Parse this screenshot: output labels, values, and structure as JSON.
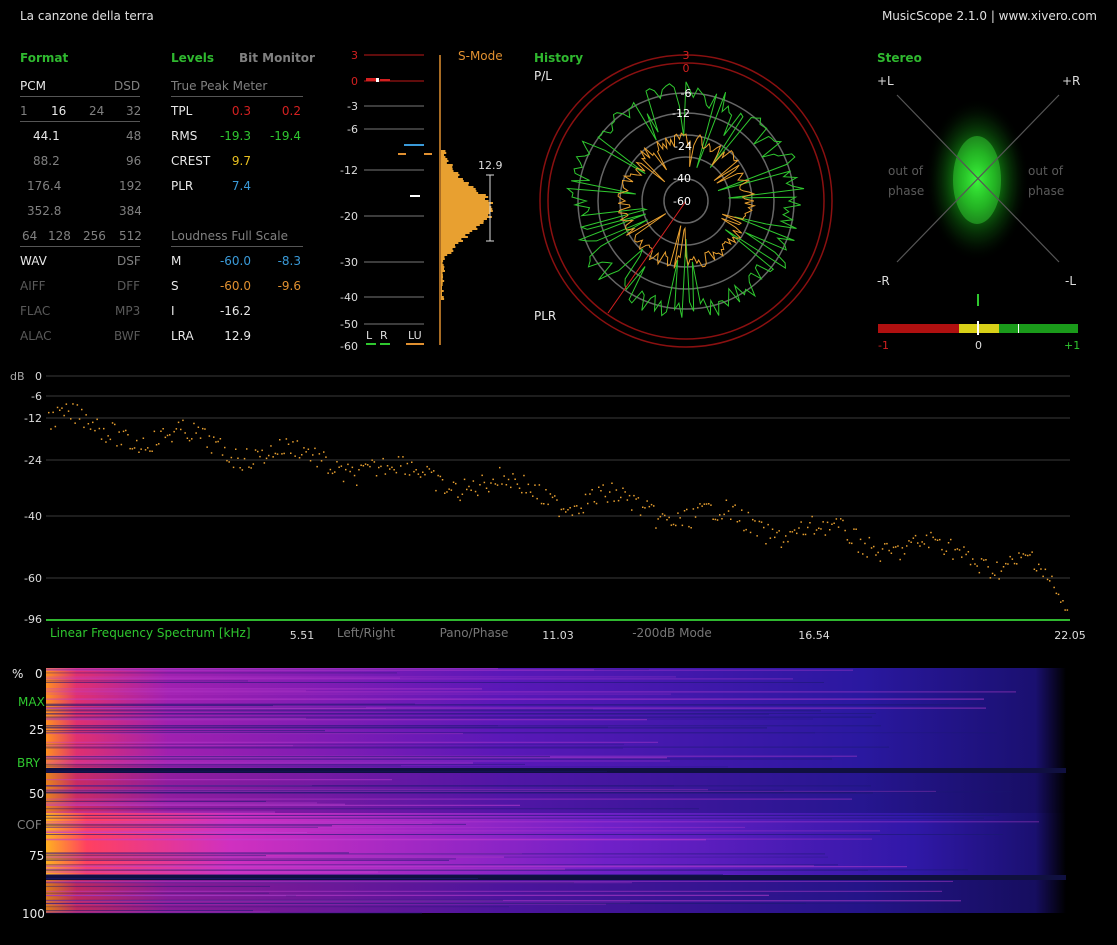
{
  "header": {
    "track_title": "La canzone della terra",
    "app_info": "MusicScope 2.1.0 | www.xivero.com"
  },
  "format": {
    "title": "Format",
    "pcm": "PCM",
    "dsd": "DSD",
    "bits": [
      "1",
      "16",
      "24",
      "32"
    ],
    "rates_pcm": [
      "44.1",
      "88.2",
      "176.4",
      "352.8"
    ],
    "rates_dsd": [
      "48",
      "96",
      "192",
      "384"
    ],
    "dsd_rates": [
      "64",
      "128",
      "256",
      "512"
    ],
    "formats_left": [
      "WAV",
      "AIFF",
      "FLAC",
      "ALAC"
    ],
    "formats_right": [
      "DSF",
      "DFF",
      "MP3",
      "BWF"
    ]
  },
  "levels": {
    "title": "Levels",
    "bit_monitor": "Bit Monitor",
    "true_peak_title": "True Peak Meter",
    "rows": [
      {
        "label": "TPL",
        "l": "0.3",
        "r": "0.2"
      },
      {
        "label": "RMS",
        "l": "-19.3",
        "r": "-19.4"
      },
      {
        "label": "CREST",
        "l": "9.7",
        "r": ""
      },
      {
        "label": "PLR",
        "l": "7.4",
        "r": ""
      }
    ],
    "loudness_title": "Loudness Full Scale",
    "loud_rows": [
      {
        "label": "M",
        "l": "-60.0",
        "r": "-8.3"
      },
      {
        "label": "S",
        "l": "-60.0",
        "r": "-9.6"
      },
      {
        "label": "I",
        "l": "-16.2",
        "r": ""
      },
      {
        "label": "LRA",
        "l": "12.9",
        "r": ""
      }
    ]
  },
  "meter": {
    "smode": "S-Mode",
    "scale": [
      "3",
      "0",
      "-3",
      "-6",
      "-12",
      "-20",
      "-30",
      "-40",
      "-50",
      "-60"
    ],
    "lra_value": "12.9",
    "labels": [
      "L",
      "R",
      "LU"
    ]
  },
  "history": {
    "title": "History",
    "pl": "P/L",
    "plr": "PLR",
    "rings": [
      "3",
      "0",
      "-6",
      "-12",
      "-24",
      "-40",
      "-60"
    ]
  },
  "stereo": {
    "title": "Stereo",
    "pl": "+L",
    "pr": "+R",
    "ml": "-R",
    "mr": "-L",
    "oop1": "out of",
    "oop2": "phase",
    "corr": [
      "-1",
      "0",
      "+1"
    ]
  },
  "spectrum": {
    "db_label": "dB",
    "y_ticks": [
      "0",
      "-6",
      "-12",
      "-24",
      "-40",
      "-60",
      "-96"
    ],
    "x_title": "Linear Frequency Spectrum [kHz]",
    "x_ticks": [
      "5.51",
      "11.03",
      "16.54",
      "22.05"
    ],
    "modes": [
      "Left/Right",
      "Pano/Phase",
      "-200dB Mode"
    ]
  },
  "spectrogram": {
    "y_labels": [
      "%",
      "0",
      "MAX",
      "25",
      "BRY",
      "50",
      "COF",
      "75",
      "100"
    ]
  },
  "colors": {
    "accent": "#2fb82f",
    "red": "#d42020",
    "orange": "#e09030",
    "blue": "#3a9ad8"
  }
}
